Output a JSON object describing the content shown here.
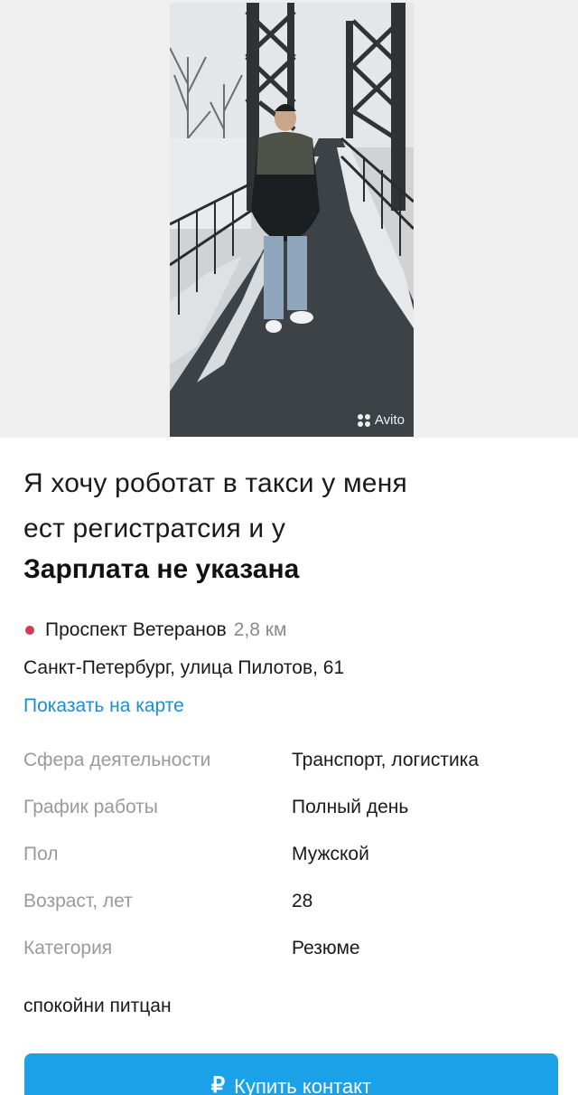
{
  "photo": {
    "watermark": "Avito"
  },
  "ad": {
    "title_line1": "Я хочу роботат в такси у меня",
    "title_line2": "ест регистратсия и у",
    "salary": "Зарплата не указана"
  },
  "location": {
    "metro": "Проспект Ветеранов",
    "distance": "2,8 км",
    "address": "Санкт-Петербург, улица Пилотов, 61",
    "map_link": "Показать на карте",
    "metro_color": "#d23a55"
  },
  "params": [
    {
      "key": "Сфера деятельности",
      "value": "Транспорт, логистика"
    },
    {
      "key": "График работы",
      "value": "Полный день"
    },
    {
      "key": "Пол",
      "value": "Мужской"
    },
    {
      "key": "Возраст, лет",
      "value": "28"
    },
    {
      "key": "Категория",
      "value": "Резюме"
    }
  ],
  "description": "спокойни питцан",
  "buy_button": {
    "icon": "₽",
    "label": "Купить контакт",
    "color": "#1ba1e8"
  }
}
